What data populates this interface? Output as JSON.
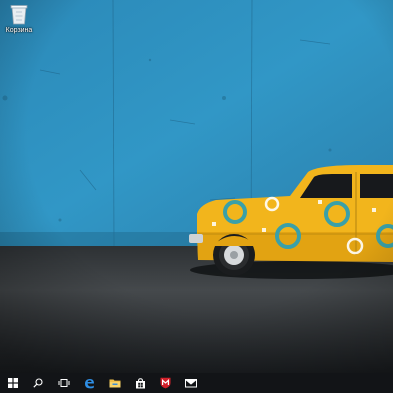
{
  "desktop": {
    "icons": [
      {
        "label": "Корзина",
        "icon": "recycle-bin-icon"
      }
    ],
    "wallpaper": {
      "subject": "yellow-retro-car",
      "wall_color": "#2e8ec0",
      "floor_color": "#3a3d40",
      "car_color": "#f2b51c",
      "accent_color": "#3aa0a8"
    }
  },
  "taskbar": {
    "background": "#121417",
    "items": [
      {
        "icon": "windows-start-icon"
      },
      {
        "icon": "search-icon"
      },
      {
        "icon": "task-view-icon"
      },
      {
        "icon": "edge-browser-icon"
      },
      {
        "icon": "file-explorer-icon"
      },
      {
        "icon": "store-icon"
      },
      {
        "icon": "mcafee-icon"
      },
      {
        "icon": "mail-icon"
      }
    ]
  }
}
